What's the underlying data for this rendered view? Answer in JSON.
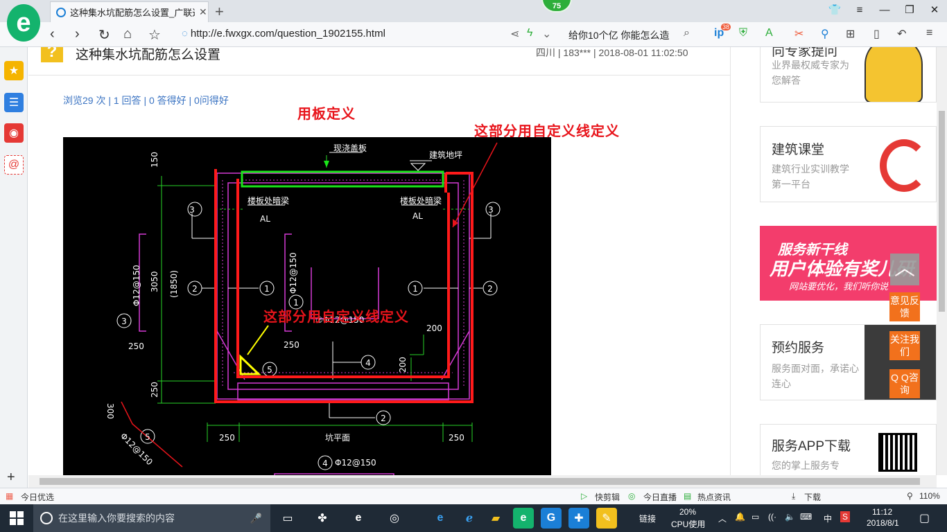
{
  "browser": {
    "tab_title": "这种集水坑配筋怎么设置_广联达",
    "tab_close": "✕",
    "new_tab": "+",
    "badge": "75",
    "url": "http://e.fwxgx.com/question_1902155.html",
    "search_text": "给你10个亿 你能怎么造",
    "ext_badge": "38"
  },
  "page": {
    "question_icon": "?",
    "title": "这种集水坑配筋怎么设置",
    "meta": "四川 | 183*** | 2018-08-01 11:02:50",
    "stats": "浏览29 次 | 1 回答 | 0 答得好 | 0问得好",
    "annotations": {
      "top": "用板定义",
      "right": "这部分用自定义线定义",
      "middle": "这部分用自定义线定义"
    }
  },
  "cad": {
    "labels": {
      "slab": "现浇盖板",
      "grade": "建筑地坪",
      "beam_left": "楼板处暗梁",
      "beam_right": "楼板处暗梁",
      "al_left": "AL",
      "al_right": "AL",
      "dim_150": "150",
      "dim_3050": "3050",
      "dim_1850": "(1850)",
      "dim_250a": "250",
      "dim_250b": "250",
      "dim_250c": "250",
      "dim_250d": "250",
      "dim_250e": "250",
      "dim_200a": "200",
      "dim_200b": "200",
      "dim_300": "300",
      "rebar_v": "Φ12@150",
      "rebar_left": "Φ12@150",
      "rebar_mid": "②Φ12@150",
      "rebar_bottom": "Φ12@150",
      "rebar_diag": "Φ12@150",
      "bottom_label": "坑平面",
      "m1": "1",
      "m2": "2",
      "m3": "3",
      "m4": "4",
      "m5": "5"
    }
  },
  "sidebar_cards": [
    {
      "title": "向专家提问",
      "sub": "业界最权威专家为您解答"
    },
    {
      "title": "建筑课堂",
      "sub": "建筑行业实训教学第一平台"
    },
    {
      "title": "预约服务",
      "sub": "服务面对面，承诺心连心"
    },
    {
      "title": "服务APP下载",
      "sub": "您的掌上服务专"
    }
  ],
  "banner": {
    "line1": "服务新干线",
    "line2": "用户体验有奖儿研",
    "line3": "网站要优化，我们听你说"
  },
  "float_buttons": [
    "意见反馈",
    "关注我们",
    "Q Q咨询"
  ],
  "statusbar": {
    "left": "今日优选",
    "items": [
      "快剪辑",
      "今日直播",
      "热点资讯",
      "下载"
    ],
    "zoom": "110%"
  },
  "taskbar": {
    "search_placeholder": "在这里输入你要搜索的内容",
    "link_label": "链接",
    "cpu": "20%",
    "cpu_label": "CPU使用",
    "ime": "中",
    "time": "11:12",
    "date": "2018/8/1"
  }
}
